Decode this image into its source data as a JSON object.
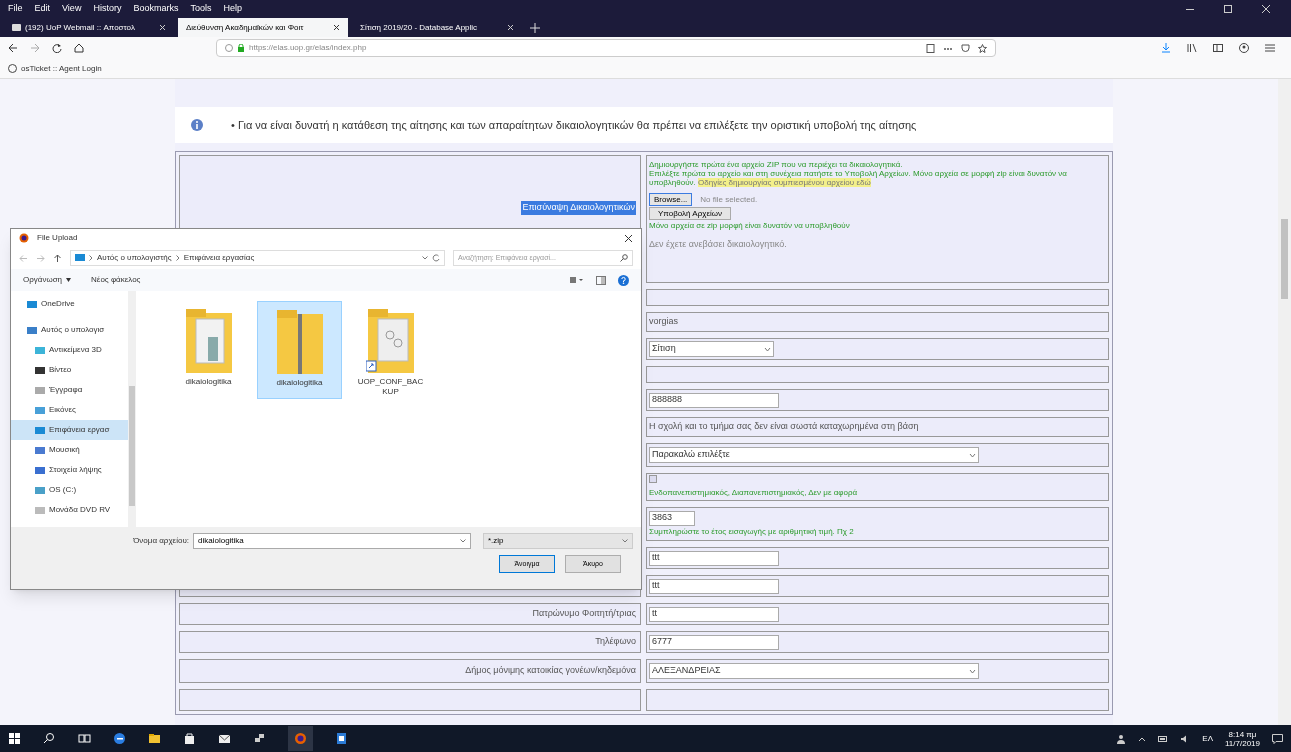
{
  "browser": {
    "menu": [
      "File",
      "Edit",
      "View",
      "History",
      "Bookmarks",
      "Tools",
      "Help"
    ],
    "tabs": [
      {
        "label": "(192) UoP Webmail :: Αποστολ",
        "selected": false
      },
      {
        "label": "Διεύθυνση Ακαδημαϊκών και Φοιτ",
        "selected": true
      },
      {
        "label": "Σίτιση 2019/20 - Database Applic",
        "selected": false
      }
    ],
    "url": "https://elas.uop.gr/elas/index.php",
    "bookmarks": [
      "osTicket :: Agent Login"
    ]
  },
  "page": {
    "info": "• Για να είναι δυνατή η κατάθεση της αίτησης και των απαραίτητων δικαιολογητικών θα πρέπει να επιλέξετε την οριστική υποβολή της αίτησης",
    "upload": {
      "label": "Επισύναψη Δικαιολογητικών",
      "instructions": "Δημιουργήστε πρώτα ένα αρχείο ZIP που να περιέχει τα δικαιολογητικά.",
      "instructions_2": "Επιλέξτε πρώτα το αρχείο και στη συνέχεια πατήστε το Υποβολή Αρχείων. Μόνο αρχεία σε μορφή zip είναι δυνατόν να υποβληθούν.",
      "link": "Οδηγίες δημιουργίας συμπιεσμένου αρχείου εδώ",
      "browse": "Browse...",
      "no_file": "No file selected.",
      "submit": "Υποβολή Αρχείων",
      "note": "Μόνο αρχεία σε zip μορφή είναι δυνατόν να υποβληθούν",
      "status": "Δεν έχετε ανεβάσει δικαιολογητικό."
    },
    "rows": [
      {
        "kind": "empty"
      },
      {
        "kind": "text",
        "value": "vorgias"
      },
      {
        "kind": "short_select",
        "value": "Σίτιση"
      },
      {
        "kind": "empty"
      },
      {
        "kind": "input",
        "value": "888888"
      },
      {
        "kind": "text",
        "value": "Η σχολή και το τμήμα σας δεν είναι σωστά καταχωρημένα στη βάση"
      },
      {
        "kind": "long_select",
        "value": "Παρακαλώ επιλέξτε"
      },
      {
        "kind": "checkbox",
        "checked": false,
        "note": "Ενδοπανεπιστημιακός, Διαπανεπιστημιακός, Δεν με αφορά"
      },
      {
        "kind": "number_input",
        "value": "3863",
        "note": "Συμπληρώστε το έτος εισαγωγής με αριθμητική τιμή. Πχ 2"
      },
      {
        "kind": "input",
        "value": "ttt"
      },
      {
        "kind": "input",
        "value": "ttt"
      },
      {
        "kind": "input",
        "label": "Πατρώνυμο Φοιτητή/τριας",
        "value": "tt"
      },
      {
        "kind": "input",
        "label": "Τηλέφωνο",
        "value": "6777"
      },
      {
        "kind": "long_select",
        "label": "Δήμος μόνιμης κατοικίας γονέων/κηδεμόνα",
        "value": "ΑΛΕΞΑΝΔΡΕΙΑΣ"
      }
    ]
  },
  "dialog": {
    "title": "File Upload",
    "path": [
      "Αυτός ο υπολογιστής",
      "Επιφάνεια εργασίας"
    ],
    "search_placeholder": "Αναζήτηση: Επιφάνεια εργασί...",
    "organize": "Οργάνωση",
    "new_folder": "Νέος φάκελος",
    "nav": [
      {
        "label": "OneDrive",
        "selected": false
      },
      {
        "label": "Αυτός ο υπολογισ",
        "selected": false
      },
      {
        "label": "Αντικείμενα 3D",
        "selected": false
      },
      {
        "label": "Βίντεο",
        "selected": false
      },
      {
        "label": "Έγγραφα",
        "selected": false
      },
      {
        "label": "Εικόνες",
        "selected": false
      },
      {
        "label": "Επιφάνεια εργασ",
        "selected": true
      },
      {
        "label": "Μουσική",
        "selected": false
      },
      {
        "label": "Στοιχεία λήψης",
        "selected": false
      },
      {
        "label": "OS (C:)",
        "selected": false
      },
      {
        "label": "Μονάδα DVD RV",
        "selected": false
      }
    ],
    "files": [
      {
        "kind": "folder",
        "name": "dikaiologitika",
        "selected": false
      },
      {
        "kind": "zip",
        "name": "dikaiologitika",
        "selected": true
      },
      {
        "kind": "shortcut",
        "name": "UOP_CONF_BACKUP",
        "selected": false
      }
    ],
    "filename_label": "Όνομα αρχείου:",
    "filename": "dikaiologitika",
    "filter": "*.zip",
    "open": "Άνοιγμα",
    "cancel": "Άκυρο"
  },
  "taskbar": {
    "language": "ΕΛ",
    "time": "8:14 πμ",
    "date": "11/7/2019"
  }
}
